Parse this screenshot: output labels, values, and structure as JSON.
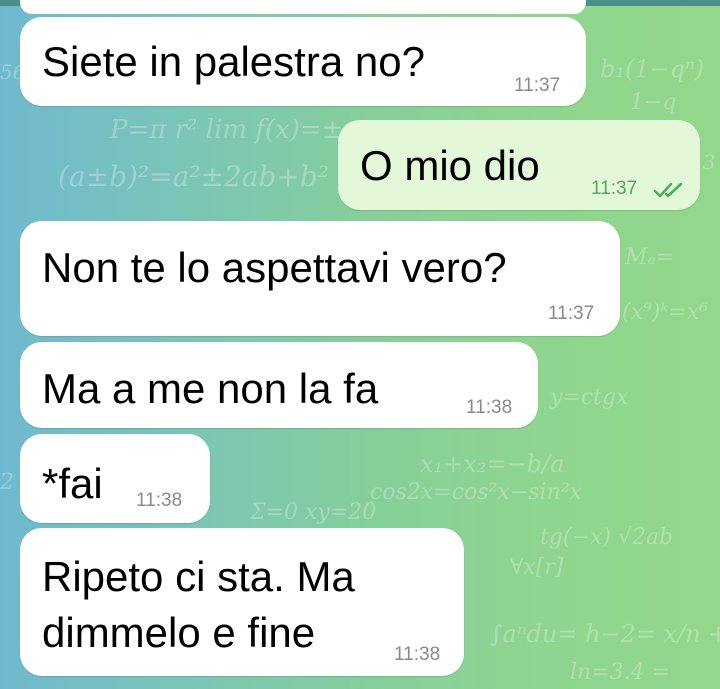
{
  "chat": {
    "messages": [
      {
        "direction": "incoming",
        "text": "Siete in palestra no?",
        "time": "11:37"
      },
      {
        "direction": "outgoing",
        "text": "O mio dio",
        "time": "11:37",
        "status_icon": "double-check-icon"
      },
      {
        "direction": "incoming",
        "text": "Non te lo aspettavi vero?",
        "time": "11:37"
      },
      {
        "direction": "incoming",
        "text": "Ma a me non la fa",
        "time": "11:38"
      },
      {
        "direction": "incoming",
        "text": "*fai",
        "time": "11:38"
      },
      {
        "direction": "incoming",
        "lines": [
          "Ripeto ci sta. Ma",
          "dimmelo e fine"
        ],
        "time": "11:38"
      }
    ]
  },
  "colors": {
    "incoming_bubble": "#ffffff",
    "outgoing_bubble": "#e3f8d8",
    "time_incoming": "#8a8a8a",
    "time_outgoing": "#5aa65a",
    "check_marks": "#4caf50"
  }
}
